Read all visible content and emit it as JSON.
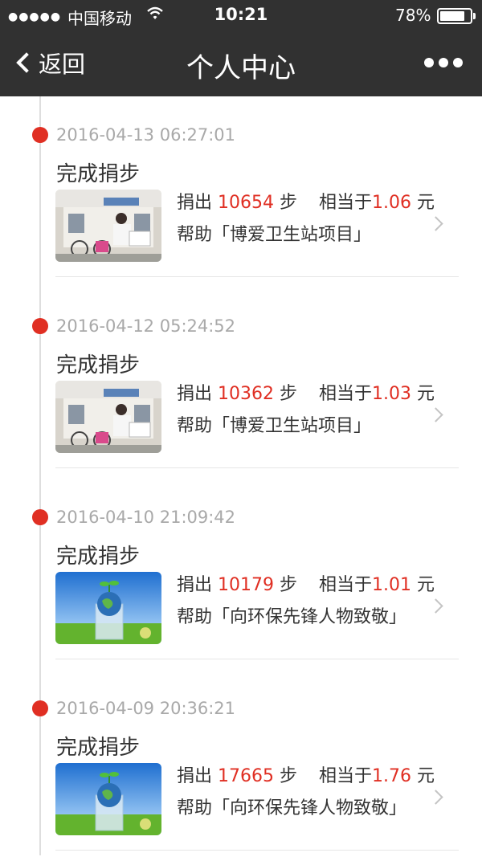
{
  "status_bar": {
    "signal": "●●●●●",
    "carrier": "中国移动",
    "wifi_icon": "wifi-icon",
    "time": "10:21",
    "battery": "78%"
  },
  "nav": {
    "back_label": "返回",
    "title": "个人中心",
    "more_icon": "more-dots-icon"
  },
  "records": [
    {
      "time": "2016-04-13 06:27:01",
      "title": "完成捐步",
      "donate_prefix": "捐出",
      "steps": "10654",
      "steps_unit": "步",
      "equiv_prefix": "相当于",
      "amount": "1.06",
      "amount_unit": "元",
      "project": "帮助「博爱卫生站项目」",
      "image": "clinic-photo"
    },
    {
      "time": "2016-04-12 05:24:52",
      "title": "完成捐步",
      "donate_prefix": "捐出",
      "steps": "10362",
      "steps_unit": "步",
      "equiv_prefix": "相当于",
      "amount": "1.03",
      "amount_unit": "元",
      "project": "帮助「博爱卫生站项目」",
      "image": "clinic-photo"
    },
    {
      "time": "2016-04-10 21:09:42",
      "title": "完成捐步",
      "donate_prefix": "捐出",
      "steps": "10179",
      "steps_unit": "步",
      "equiv_prefix": "相当于",
      "amount": "1.01",
      "amount_unit": "元",
      "project": "帮助「向环保先锋人物致敬」",
      "image": "globe-sprout-photo"
    },
    {
      "time": "2016-04-09 20:36:21",
      "title": "完成捐步",
      "donate_prefix": "捐出",
      "steps": "17665",
      "steps_unit": "步",
      "equiv_prefix": "相当于",
      "amount": "1.76",
      "amount_unit": "元",
      "project": "帮助「向环保先锋人物致敬」",
      "image": "globe-sprout-photo"
    }
  ],
  "colors": {
    "bar_bg": "#313131",
    "accent_red": "#e02f23",
    "timestamp_gray": "#a9a9a9",
    "text_dark": "#333333"
  }
}
